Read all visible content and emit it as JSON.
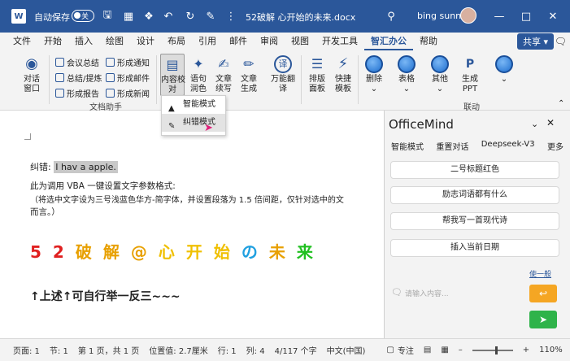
{
  "titlebar": {
    "autosave_label": "自动保存",
    "autosave_state": "关",
    "filename": "52破解 心开始的未来.docx",
    "user": "bing sunny"
  },
  "tabs": [
    "文件",
    "开始",
    "插入",
    "绘图",
    "设计",
    "布局",
    "引用",
    "邮件",
    "审阅",
    "视图",
    "开发工具",
    "智汇办公",
    "帮助"
  ],
  "active_tab": "智汇办公",
  "share_label": "共享",
  "ribbon": {
    "dialog_window": "对话\n窗口",
    "meeting_summary": "会议总结",
    "summary_outline": "总结/提炼",
    "form_report": "形成报告",
    "form_notice": "形成通知",
    "form_mail": "形成邮件",
    "form_news": "形成新闻",
    "group_doc_assistant": "文档助手",
    "content_check": "内容校\n对",
    "polish": "语句\n润色",
    "continue_write": "文章\n续写",
    "generate_article": "文章\n生成",
    "translate": "万能翻\n译",
    "layout_panel": "排版\n面板",
    "quick_layout": "快捷\n模板",
    "delete": "删除",
    "table": "表格",
    "other": "其他",
    "gen_ppt": "生成\nPPT",
    "group_link": "联动"
  },
  "dropdown": {
    "smart_mode": "智能模式",
    "error_mode": "纠错模式"
  },
  "document": {
    "line1_label": "纠错: ",
    "line1_text": "I hav a apple.",
    "line2": "此为调用 VBA 一键设置文字参数格式:",
    "line3": "（将选中文字设为三号浅蓝色华方-简字体，并设置段落为 1.5 倍间距，仅针对选中的文",
    "line4": "而言。）",
    "fancy_chars": [
      "5",
      "2",
      "破",
      "解",
      "@",
      "心",
      "开",
      "始",
      "の",
      "未",
      "来"
    ],
    "fancy_colors": [
      "#e02020",
      "#e02020",
      "#e8a000",
      "#e8a000",
      "#e8a000",
      "#f0c000",
      "#f0c000",
      "#f0c000",
      "#20a0e0",
      "#e8a000",
      "#20c020"
    ],
    "bottom_line": "↑上述↑可自行举一反三~~~"
  },
  "panel": {
    "title": "OfficeMind",
    "tabs": [
      "智能模式",
      "重置对话",
      "Deepseek-V3",
      "更多"
    ],
    "buttons": [
      "二号标题红色",
      "励志词语都有什么",
      "帮我写一首现代诗",
      "插入当前日期"
    ],
    "link": "使一般",
    "input_placeholder": "请输入内容..."
  },
  "status": {
    "page": "页面: 1",
    "section": "节: 1",
    "page_of": "第 1 页，共 1 页",
    "position": "位置值: 2.7厘米",
    "row": "行: 1",
    "col": "列: 4",
    "chars": "4/117 个字",
    "lang": "中文(中国)",
    "focus": "专注",
    "zoom": "110%"
  }
}
